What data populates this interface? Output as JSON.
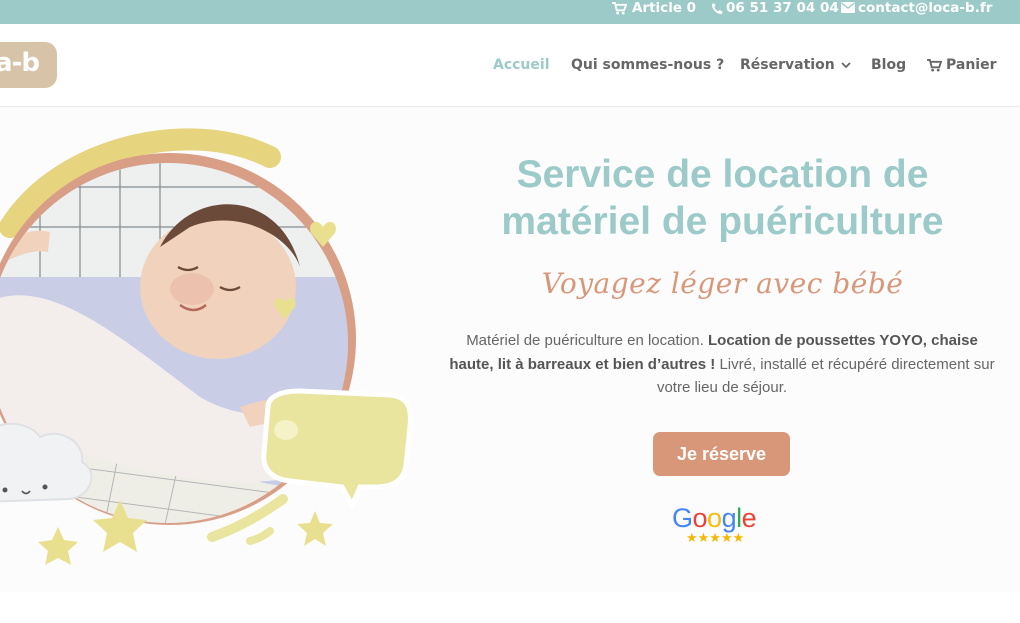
{
  "topbar": {
    "cart_label": "Article 0",
    "phone": "06 51 37 04 04",
    "email": "contact@loca-b.fr"
  },
  "header": {
    "logo_text": "a-b",
    "nav": {
      "home": "Accueil",
      "about": "Qui sommes-nous ?",
      "booking": "Réservation",
      "blog": "Blog",
      "cart": "Panier"
    }
  },
  "hero": {
    "title_line1": "Service de location de",
    "title_line2": "matériel de puériculture",
    "subtitle": "Voyagez léger avec bébé",
    "desc_part1": "Matériel de puériculture en location. ",
    "desc_bold": "Location de poussettes YOYO, chaise haute, lit à barreaux et bien d’autres !",
    "desc_part2": " Livré, installé et récupéré directement sur votre lieu de séjour.",
    "cta_label": "Je réserve",
    "review_brand": "Google",
    "review_stars": "★★★★★"
  },
  "colors": {
    "accent": "#9ccac8",
    "cta": "#d9977a",
    "logo": "#d7c3a8",
    "text": "#666666"
  },
  "icons": [
    "cart-icon",
    "phone-icon",
    "email-icon",
    "chevron-down-icon",
    "cart-icon"
  ]
}
